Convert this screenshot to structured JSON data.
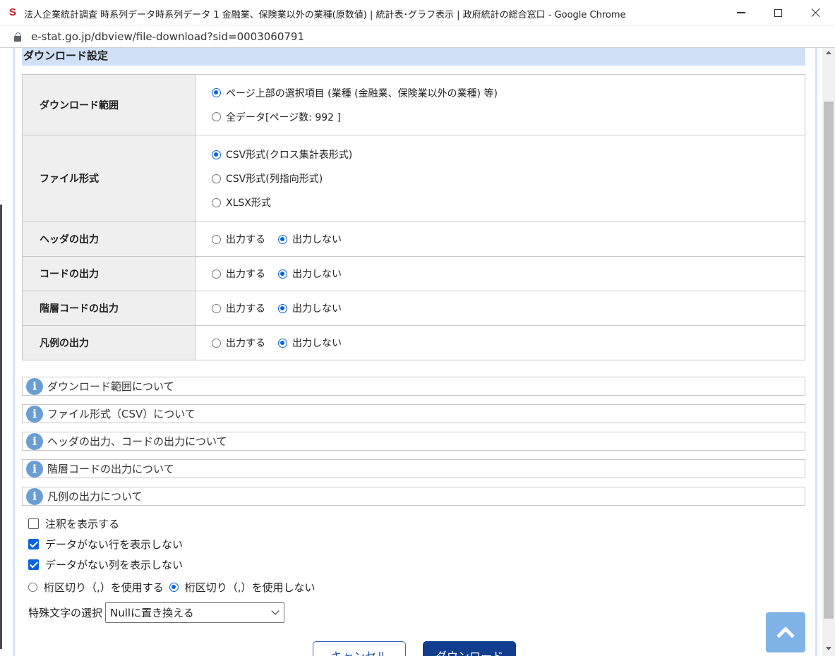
{
  "window": {
    "favicon_letter": "S",
    "title": "法人企業統計調査 時系列データ時系列データ 1 金融業、保険業以外の業種(原数値) | 統計表･グラフ表示 | 政府統計の総合窓口 - Google Chrome"
  },
  "address_bar": {
    "url": "e-stat.go.jp/dbview/file-download?sid=0003060791"
  },
  "section": {
    "title": "ダウンロード設定"
  },
  "rows": {
    "range": {
      "label": "ダウンロード範囲",
      "options": [
        "ページ上部の選択項目 (業種 (金融業、保険業以外の業種) 等)",
        "全データ[ページ数: 992 ]"
      ],
      "selected": 0
    },
    "format": {
      "label": "ファイル形式",
      "options": [
        "CSV形式(クロス集計表形式)",
        "CSV形式(列指向形式)",
        "XLSX形式"
      ],
      "selected": 0
    },
    "header": {
      "label": "ヘッダの出力",
      "options": [
        "出力する",
        "出力しない"
      ],
      "selected": 1
    },
    "code": {
      "label": "コードの出力",
      "options": [
        "出力する",
        "出力しない"
      ],
      "selected": 1
    },
    "level_code": {
      "label": "階層コードの出力",
      "options": [
        "出力する",
        "出力しない"
      ],
      "selected": 1
    },
    "legend": {
      "label": "凡例の出力",
      "options": [
        "出力する",
        "出力しない"
      ],
      "selected": 1
    }
  },
  "info_items": [
    "ダウンロード範囲について",
    "ファイル形式（CSV）について",
    "ヘッダの出力、コードの出力について",
    "階層コードの出力について",
    "凡例の出力について"
  ],
  "info_icon_glyph": "i",
  "checkboxes": [
    {
      "label": "注釈を表示する",
      "checked": false
    },
    {
      "label": "データがない行を表示しない",
      "checked": true
    },
    {
      "label": "データがない列を表示しない",
      "checked": true
    }
  ],
  "separator": {
    "options": [
      "桁区切り（,）を使用する",
      "桁区切り（,）を使用しない"
    ],
    "selected": 1
  },
  "special_chars": {
    "label": "特殊文字の選択",
    "selected_value": "Nullに置き換える"
  },
  "buttons": {
    "cancel": "キャンセル",
    "download": "ダウンロード"
  },
  "colors": {
    "accent": "#0a63d9",
    "section_header": "#cfe0f7",
    "download_button": "#113d8f",
    "info_icon": "#6a9ed3",
    "to_top_button": "#7fb2e6"
  }
}
